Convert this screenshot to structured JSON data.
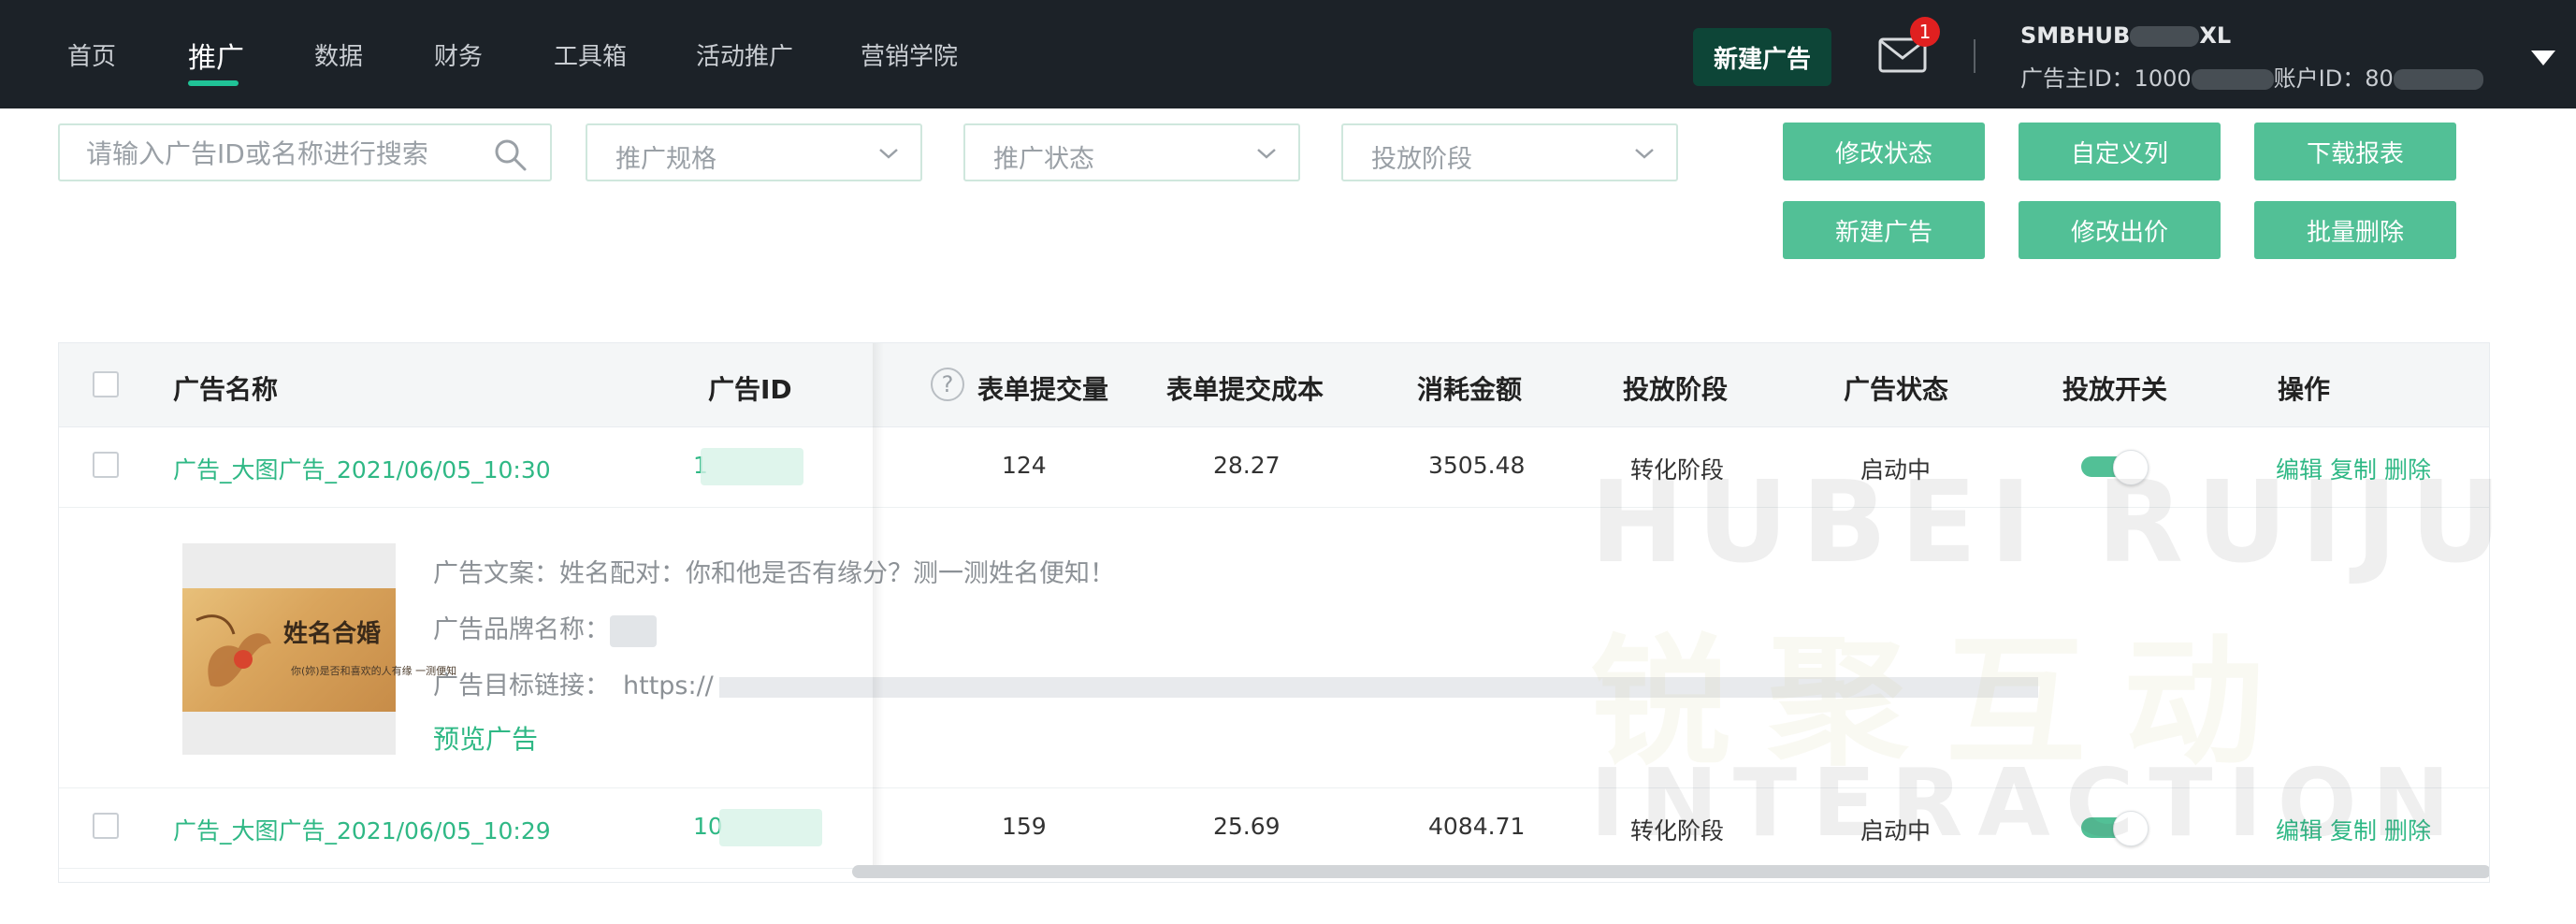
{
  "nav": {
    "items": [
      "首页",
      "推广",
      "数据",
      "财务",
      "工具箱",
      "活动推广",
      "营销学院"
    ],
    "active_index": 1,
    "accent_color": "#20c397"
  },
  "header": {
    "new_ad_label": "新建广告",
    "mail_badge": "1",
    "account_name_prefix": "SMBHUB",
    "account_name_suffix": "XL",
    "advertiser_id_label": "广告主ID：1000",
    "account_id_label": "账户ID：80"
  },
  "filters": {
    "search_placeholder": "请输入广告ID或名称进行搜索",
    "spec_placeholder": "推广规格",
    "status_placeholder": "推广状态",
    "phase_placeholder": "投放阶段"
  },
  "actions": {
    "row1": [
      "修改状态",
      "自定义列",
      "下载报表"
    ],
    "row2": [
      "新建广告",
      "修改出价",
      "批量删除"
    ],
    "button_color": "#52c096"
  },
  "table": {
    "columns": {
      "name": "广告名称",
      "id": "广告ID",
      "form_submit": "表单提交量",
      "form_cost": "表单提交成本",
      "spend": "消耗金额",
      "phase": "投放阶段",
      "status": "广告状态",
      "switch": "投放开关",
      "ops": "操作"
    },
    "rows": [
      {
        "name": "广告_大图广告_2021/06/05_10:30",
        "id_prefix": "1",
        "form_submit": "124",
        "form_cost": "28.27",
        "spend": "3505.48",
        "phase": "转化阶段",
        "status": "启动中",
        "switch_on": true,
        "ops": [
          "编辑",
          "复制",
          "删除"
        ]
      },
      {
        "name": "广告_大图广告_2021/06/05_10:29",
        "id_prefix": "10",
        "form_submit": "159",
        "form_cost": "25.69",
        "spend": "4084.71",
        "phase": "转化阶段",
        "status": "启动中",
        "switch_on": true,
        "ops": [
          "编辑",
          "复制",
          "删除"
        ]
      }
    ],
    "detail": {
      "copy_label": "广告文案：",
      "copy_value": "姓名配对：你和他是否有缘分？测一测姓名便知！",
      "brand_label": "广告品牌名称：",
      "link_label": "广告目标链接：",
      "link_value": "https://",
      "preview_label": "预览广告",
      "thumb_title": "姓名合婚",
      "thumb_sub": "你(妳)是否和喜欢的人有缘 一测便知"
    }
  },
  "watermark": {
    "line1": "HUBEI RUIJU",
    "line2": "锐聚互动",
    "line3": "INTERACTION"
  }
}
